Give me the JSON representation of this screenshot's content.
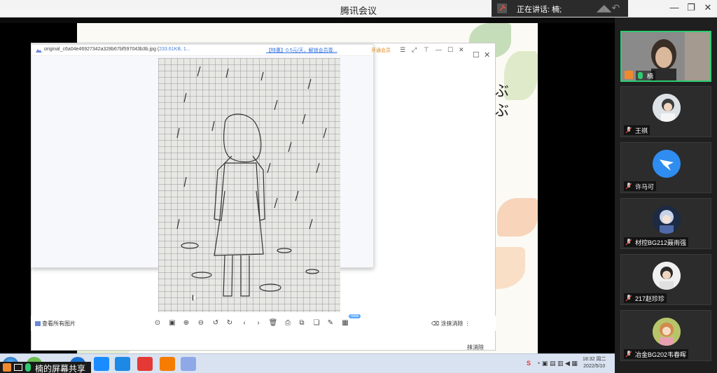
{
  "window": {
    "title": "腾讯会议",
    "speaking_label": "正在讲话: 楠;",
    "minimize": "—",
    "restore": "❐",
    "close": "✕"
  },
  "viewer": {
    "filename": "original_c6a04e46927342a328b67bf597043b3b.jpg (",
    "filesize": "233.61KB, 1...",
    "promo": "【特惠】0.5元/天，解锁会员尊...",
    "vip": "开通会员",
    "view_all": "查看所有图片",
    "new_badge": "new",
    "erase": "涂抹消除",
    "erase_back": "抹消除"
  },
  "slide": {
    "vertical_text": "ぶ ぶ"
  },
  "share": {
    "label": "楠的屏幕共享"
  },
  "taskbar": {
    "time": "18:32 周二",
    "date": "2022/5/10"
  },
  "participants": [
    {
      "name": "楠",
      "active": true
    },
    {
      "name": "王祺",
      "active": false
    },
    {
      "name": "许马可",
      "active": false
    },
    {
      "name": "材控BG212聂雨强",
      "active": false
    },
    {
      "name": "217赵珍珍",
      "active": false
    },
    {
      "name": "冶金BG202韦春晖",
      "active": false
    }
  ],
  "colors": {
    "accent_green": "#2ecc71",
    "link_blue": "#2f6fe0",
    "vip_orange": "#e08a1e",
    "dingtalk_blue": "#2f8cf0"
  },
  "icons": [
    "mic-icon",
    "window-minimize-icon",
    "restore-icon",
    "close-icon",
    "zoom-in-icon",
    "zoom-out-icon",
    "rotate-icon",
    "prev-icon",
    "next-icon",
    "delete-icon",
    "print-icon",
    "edit-icon"
  ]
}
